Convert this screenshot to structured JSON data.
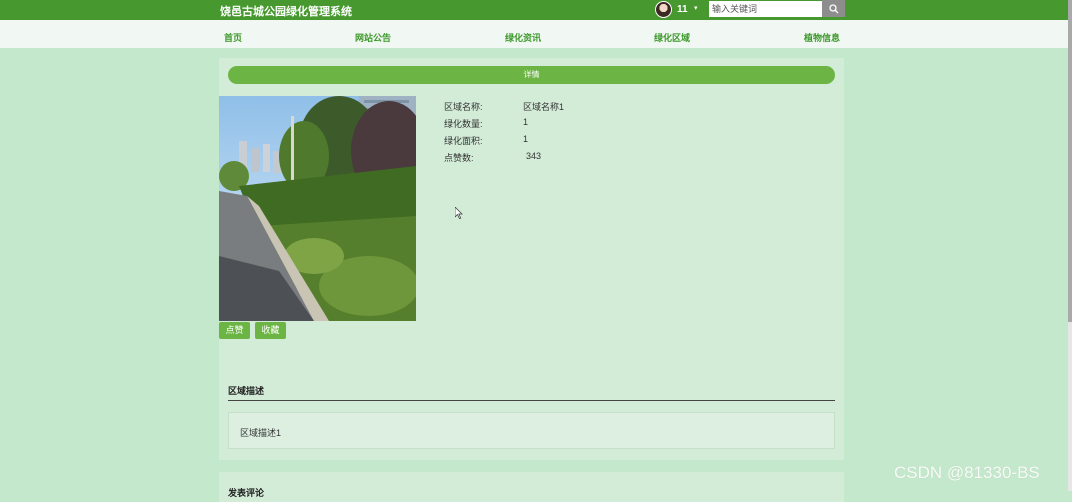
{
  "app": {
    "title": "饶邑古城公园绿化管理系统"
  },
  "user": {
    "name": "11"
  },
  "search": {
    "placeholder": "输入关键词"
  },
  "nav": {
    "items": [
      "首页",
      "网站公告",
      "绿化资讯",
      "绿化区域",
      "植物信息"
    ]
  },
  "detail": {
    "header": "详情",
    "fields": [
      {
        "label": "区域名称:",
        "value": "区域名称1"
      },
      {
        "label": "绿化数量:",
        "value": "1"
      },
      {
        "label": "绿化面积:",
        "value": "1"
      },
      {
        "label": "点赞数:",
        "value": "343"
      }
    ],
    "buttons": {
      "like": "点赞",
      "favorite": "收藏"
    }
  },
  "description": {
    "title": "区域描述",
    "text": "区域描述1"
  },
  "comments": {
    "title": "发表评论"
  },
  "watermark": "CSDN @81330-BS",
  "colors": {
    "topbar": "#47982f",
    "accent": "#6cb544",
    "background": "#c4e8cb"
  }
}
